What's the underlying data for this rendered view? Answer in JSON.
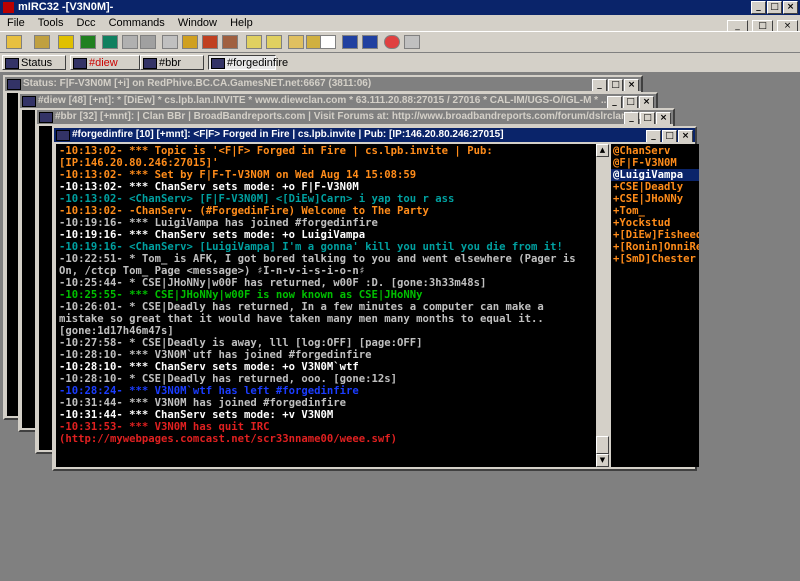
{
  "app": {
    "title": "mIRC32 -[V3N0M]-"
  },
  "window_buttons": {
    "minimize": "_",
    "maximize": "□",
    "close": "×"
  },
  "menu": [
    "File",
    "Tools",
    "Dcc",
    "Commands",
    "Window",
    "Help"
  ],
  "switchbar": [
    {
      "label": "Status"
    },
    {
      "label": "#diew"
    },
    {
      "label": "#bbr"
    },
    {
      "label": "#forgedinfire"
    }
  ],
  "windows": {
    "status": {
      "title": "Status: F|F-V3N0M [+i] on RedPhive.BC.CA.GamesNET.net:6667 (3811:06)"
    },
    "diew": {
      "title": "#diew [48] [+nt]: * [DiEw] * cs.lpb.lan.INVITE * www.diewclan.com * 63.111.20.88:27015 / 27016 * CAL-IM/UGS-O/IGL-M * ..."
    },
    "bbr": {
      "title": "#bbr [32] [+mnt]: | Clan BBr | BroadBandreports.com | Visit Forums at: http://www.broadbandreports.com/forum/dslrclan | IP 2..."
    },
    "forged": {
      "title": "#forgedinfire [10] [+mnt]: <F|F> Forged in Fire | cs.lpb.invite | Pub: [IP:146.20.80.246:27015]"
    }
  },
  "chat_lines": [
    {
      "text": "-10:13:02- *** Topic is '<F|F> Forged in Fire | cs.lpb.invite | Pub: [IP:146.20.80.246:27015]'",
      "color": "orange"
    },
    {
      "text": "-10:13:02- *** Set by F|F-T-V3N0M on Wed Aug 14 15:08:59",
      "color": "orange"
    },
    {
      "text": "-10:13:02- *** ChanServ sets mode: +o F|F-V3N0M",
      "color": "white"
    },
    {
      "text": "-10:13:02- <ChanServ> [F|F-V3N0M] <[DiEw]Carn> i yap tou r ass",
      "color": "teal"
    },
    {
      "text": "-10:13:02- -ChanServ- (#ForgedinFire) Welcome to The Party",
      "color": "orange"
    },
    {
      "text": "-10:19:16- *** LuigiVampa has joined #forgedinfire",
      "color": "grey"
    },
    {
      "text": "-10:19:16- *** ChanServ sets mode: +o LuigiVampa",
      "color": "white"
    },
    {
      "text": "-10:19:16- <ChanServ> [LuigiVampa] I'm a gonna' kill you until you die from it!",
      "color": "teal"
    },
    {
      "text": "-10:22:51- * Tom_ is AFK, I got bored talking to you and went elsewhere (Pager is On, /ctcp Tom_ Page <message>) ♯I-n-v-i-s-i-o-n♯",
      "color": "grey"
    },
    {
      "text": "-10:25:44- * CSE|JHoNNy|w00F has returned, w00F :D. [gone:3h33m48s]",
      "color": "grey"
    },
    {
      "text": "-10:25:55- *** CSE|JHoNNy|w00F is now known as CSE|JHoNNy",
      "color": "green"
    },
    {
      "text": "-10:26:01- * CSE|Deadly has returned, In a few minutes a computer can make a mistake so great that it would have taken many men many months to equal it.. [gone:1d17h46m47s]",
      "color": "grey"
    },
    {
      "text": "-10:27:58- * CSE|Deadly is away, lll [log:OFF] [page:OFF]",
      "color": "grey"
    },
    {
      "text": "-10:28:10- *** V3N0M`utf has joined #forgedinfire",
      "color": "grey"
    },
    {
      "text": "-10:28:10- *** ChanServ sets mode: +o V3N0M`wtf",
      "color": "white"
    },
    {
      "text": "-10:28:10- * CSE|Deadly has returned, ooo. [gone:12s]",
      "color": "grey"
    },
    {
      "text": "-10:28:24- *** V3N0M`wtf has left #forgedinfire",
      "color": "blue"
    },
    {
      "text": "-10:31:44- *** V3N0M has joined #forgedinfire",
      "color": "grey"
    },
    {
      "text": "-10:31:44- *** ChanServ sets mode: +v V3N0M",
      "color": "white"
    },
    {
      "text": "-10:31:53- *** V3N0M has quit IRC (http://mywebpages.comcast.net/scr33nname00/weee.swf)",
      "color": "red"
    }
  ],
  "nicklist": [
    {
      "nick": "@ChanServ",
      "selected": false
    },
    {
      "nick": "@F|F-V3N0M",
      "selected": false
    },
    {
      "nick": "@LuigiVampa",
      "selected": true
    },
    {
      "nick": "+CSE|Deadly",
      "selected": false
    },
    {
      "nick": "+CSE|JHoNNy",
      "selected": false
    },
    {
      "nick": "+Tom_",
      "selected": false
    },
    {
      "nick": "+Yockstud",
      "selected": false
    },
    {
      "nick": "+[DiEw]Fisheed",
      "selected": false
    },
    {
      "nick": "+[Ronin]OnniRe",
      "selected": false
    },
    {
      "nick": "+[SmD]Chester",
      "selected": false
    }
  ],
  "colors": {
    "orange": "#ff8c1a",
    "white": "#ffffff",
    "teal": "#00a0a0",
    "grey": "#c0c0c0",
    "green": "#00c000",
    "blue": "#1a3cff",
    "red": "#e02020"
  }
}
